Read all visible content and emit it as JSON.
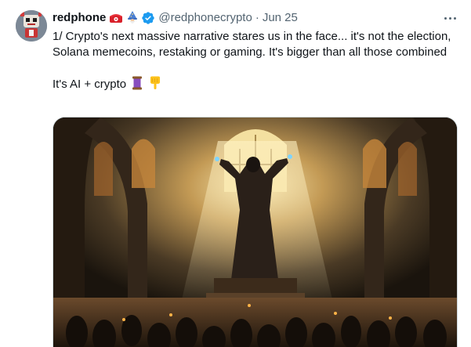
{
  "tweet": {
    "display_name": "redphone",
    "name_emojis": [
      "telephone-icon",
      "wizard-icon"
    ],
    "verified": true,
    "handle": "@redphonecrypto",
    "separator": "·",
    "date": "Jun 25",
    "line1": "1/ Crypto's next massive narrative stares us in the face... it's not the election, Solana memecoins, restaking or gaming. It's bigger than all those combined",
    "line2": "It's AI + crypto",
    "line2_emojis": [
      "thread-spool-icon",
      "pointing-down-icon"
    ]
  },
  "colors": {
    "text": "#0f1419",
    "secondary": "#536471",
    "verified_blue": "#1d9bf0",
    "border": "#cfd9de"
  },
  "media": {
    "kind": "image",
    "subject": "robed figure with raised arms in a gothic cathedral before a crowd"
  }
}
